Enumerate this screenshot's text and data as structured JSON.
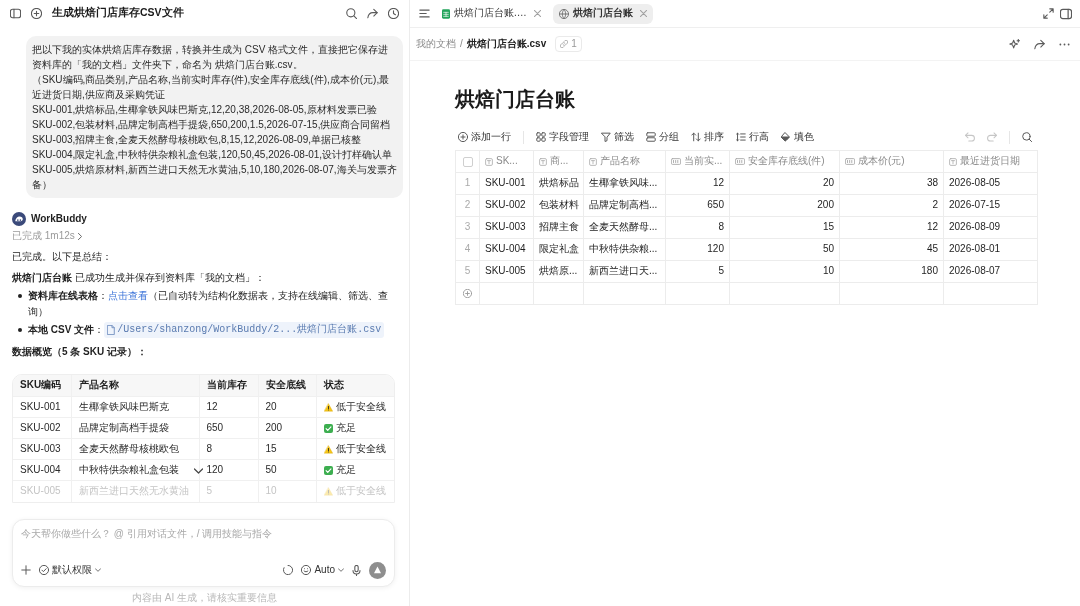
{
  "left_pane": {
    "header": {
      "title": "生成烘焙门店库存CSV文件"
    },
    "user_message": {
      "paragraphs": [
        "把以下我的实体烘焙店库存数据，转换并生成为 CSV 格式文件，直接把它保存进资料库的「我的文档」文件夹下，命名为 烘焙门店台账.csv。",
        "（SKU编码,商品类别,产品名称,当前实时库存(件),安全库存底线(件),成本价(元),最近进货日期,供应商及采购凭证",
        "SKU-001,烘焙标品,生椰拿铁风味巴斯克,12,20,38,2026-08-05,原材料发票已验",
        "SKU-002,包装材料,品牌定制高档手提袋,650,200,1.5,2026-07-15,供应商合同留档",
        "SKU-003,招牌主食,全麦天然酵母核桃欧包,8,15,12,2026-08-09,单据已核整",
        "SKU-004,限定礼盒,中秋特供杂粮礼盒包装,120,50,45,2026-08-01,设计打样确认单",
        "SKU-005,烘焙原材料,新西兰进口天然无水黄油,5,10,180,2026-08-07,海关与发票齐备）"
      ]
    },
    "assistant": {
      "name": "WorkBuddy",
      "status": "已完成 1m12s",
      "intro": "已完成。以下是总结：",
      "summary": "**烘焙门店台账** 已成功生成并保存到资料库「我的文档」：",
      "bullets": [
        {
          "kind": "link",
          "label": "**资料库在线表格**：",
          "link": "点击查看",
          "after": "（已自动转为结构化数据表，支持在线编辑、筛选、查询）"
        },
        {
          "kind": "file",
          "label": "**本地 CSV 文件**：",
          "file": "/Users/shanzong/WorkBuddy/2...烘焙门店台账.csv"
        }
      ],
      "overview_heading": "数据概览（5 条 SKU 记录）："
    },
    "table": {
      "columns": [
        "SKU编码",
        "产品名称",
        "当前库存",
        "安全底线",
        "状态"
      ],
      "rows": [
        {
          "cells": [
            "SKU-001",
            "生椰拿铁风味巴斯克",
            "12",
            "20"
          ],
          "status": {
            "kind": "warning",
            "text": "低于安全线"
          },
          "dimmed": false
        },
        {
          "cells": [
            "SKU-002",
            "品牌定制高档手提袋",
            "650",
            "200"
          ],
          "status": {
            "kind": "ok",
            "text": "充足"
          },
          "dimmed": false
        },
        {
          "cells": [
            "SKU-003",
            "全麦天然酵母核桃欧包",
            "8",
            "15"
          ],
          "status": {
            "kind": "warning",
            "text": "低于安全线"
          },
          "dimmed": false
        },
        {
          "cells": [
            "SKU-004",
            "中秋特供杂粮礼盒包装",
            "120",
            "50"
          ],
          "status": {
            "kind": "ok",
            "text": "充足"
          },
          "dimmed": false
        },
        {
          "cells": [
            "SKU-005",
            "新西兰进口天然无水黄油",
            "5",
            "10"
          ],
          "status": {
            "kind": "warning",
            "text": "低于安全线"
          },
          "dimmed": true
        }
      ]
    },
    "composer": {
      "placeholder": "今天帮你做些什么？ @ 引用对话文件，/ 调用技能与指令",
      "permission": "默认权限",
      "model": "Auto",
      "send_disabled": true
    },
    "footer": "内容由 AI 生成，请核实重要信息"
  },
  "right_pane": {
    "tabs": [
      {
        "label": "烘焙门店台账.…",
        "kind": "sheet",
        "selected": false
      },
      {
        "label": "烘焙门店台账",
        "kind": "web",
        "selected": true
      }
    ],
    "breadcrumb": {
      "parent": "我的文档",
      "separator": "/",
      "current": "烘焙门店台账.csv",
      "link_count": "1"
    },
    "title": "烘焙门店台账",
    "toolbar": [
      {
        "kind": "add",
        "label": "添加一行"
      },
      {
        "kind": "fields",
        "label": "字段管理"
      },
      {
        "kind": "filter",
        "label": "筛选"
      },
      {
        "kind": "group",
        "label": "分组"
      },
      {
        "kind": "sort",
        "label": "排序"
      },
      {
        "kind": "rowheight",
        "label": "行高"
      },
      {
        "kind": "fill",
        "label": "填色"
      }
    ],
    "history": [
      {
        "kind": "undo",
        "disabled": true
      },
      {
        "kind": "redo",
        "disabled": true
      }
    ],
    "table": {
      "select_all_checked": false,
      "columns": [
        {
          "kind": "text",
          "label": "SK..."
        },
        {
          "kind": "text",
          "label": "商..."
        },
        {
          "kind": "text",
          "label": "产品名称"
        },
        {
          "kind": "number",
          "label": "当前实..."
        },
        {
          "kind": "number",
          "label": "安全库存底线(件)"
        },
        {
          "kind": "number",
          "label": "成本价(元)"
        },
        {
          "kind": "text",
          "label": "最近进货日期"
        }
      ],
      "rows": [
        {
          "number": "1",
          "cells": [
            "SKU-001",
            "烘焙标品",
            "生椰拿铁风味...",
            "12",
            "20",
            "38",
            "2026-08-05"
          ]
        },
        {
          "number": "2",
          "cells": [
            "SKU-002",
            "包装材料",
            "品牌定制高档...",
            "650",
            "200",
            "2",
            "2026-07-15"
          ]
        },
        {
          "number": "3",
          "cells": [
            "SKU-003",
            "招牌主食",
            "全麦天然酵母...",
            "8",
            "15",
            "12",
            "2026-08-09"
          ]
        },
        {
          "number": "4",
          "cells": [
            "SKU-004",
            "限定礼盒",
            "中秋特供杂粮...",
            "120",
            "50",
            "45",
            "2026-08-01"
          ]
        },
        {
          "number": "5",
          "cells": [
            "SKU-005",
            "烘焙原...",
            "新西兰进口天...",
            "5",
            "10",
            "180",
            "2026-08-07"
          ]
        }
      ]
    }
  }
}
